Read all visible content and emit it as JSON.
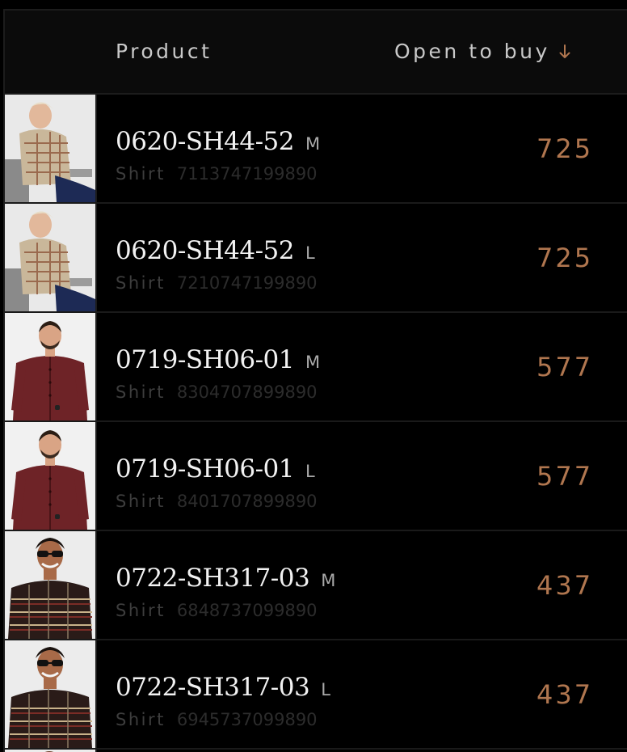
{
  "table": {
    "header": {
      "product_label": "Product",
      "open_to_buy_label": "Open to buy",
      "sort_icon": "arrow-down-icon"
    },
    "rows": [
      {
        "sku": "0620-SH44-52",
        "size": "M",
        "category": "Shirt",
        "barcode": "7113747199890",
        "open_to_buy": "725",
        "thumbnail": "model-checked-shirt-seated"
      },
      {
        "sku": "0620-SH44-52",
        "size": "L",
        "category": "Shirt",
        "barcode": "7210747199890",
        "open_to_buy": "725",
        "thumbnail": "model-checked-shirt-seated"
      },
      {
        "sku": "0719-SH06-01",
        "size": "M",
        "category": "Shirt",
        "barcode": "8304707899890",
        "open_to_buy": "577",
        "thumbnail": "model-maroon-shirt"
      },
      {
        "sku": "0719-SH06-01",
        "size": "L",
        "category": "Shirt",
        "barcode": "8401707899890",
        "open_to_buy": "577",
        "thumbnail": "model-maroon-shirt"
      },
      {
        "sku": "0722-SH317-03",
        "size": "M",
        "category": "Shirt",
        "barcode": "6848737099890",
        "open_to_buy": "437",
        "thumbnail": "model-dark-check-shirt-sunglasses"
      },
      {
        "sku": "0722-SH317-03",
        "size": "L",
        "category": "Shirt",
        "barcode": "6945737099890",
        "open_to_buy": "437",
        "thumbnail": "model-dark-check-shirt-sunglasses"
      }
    ]
  },
  "colors": {
    "background": "#000000",
    "header_background": "#0b0b0b",
    "accent_value": "#b0764f",
    "sku_text": "#f2f2f2",
    "muted_text": "#3d3d3d"
  }
}
